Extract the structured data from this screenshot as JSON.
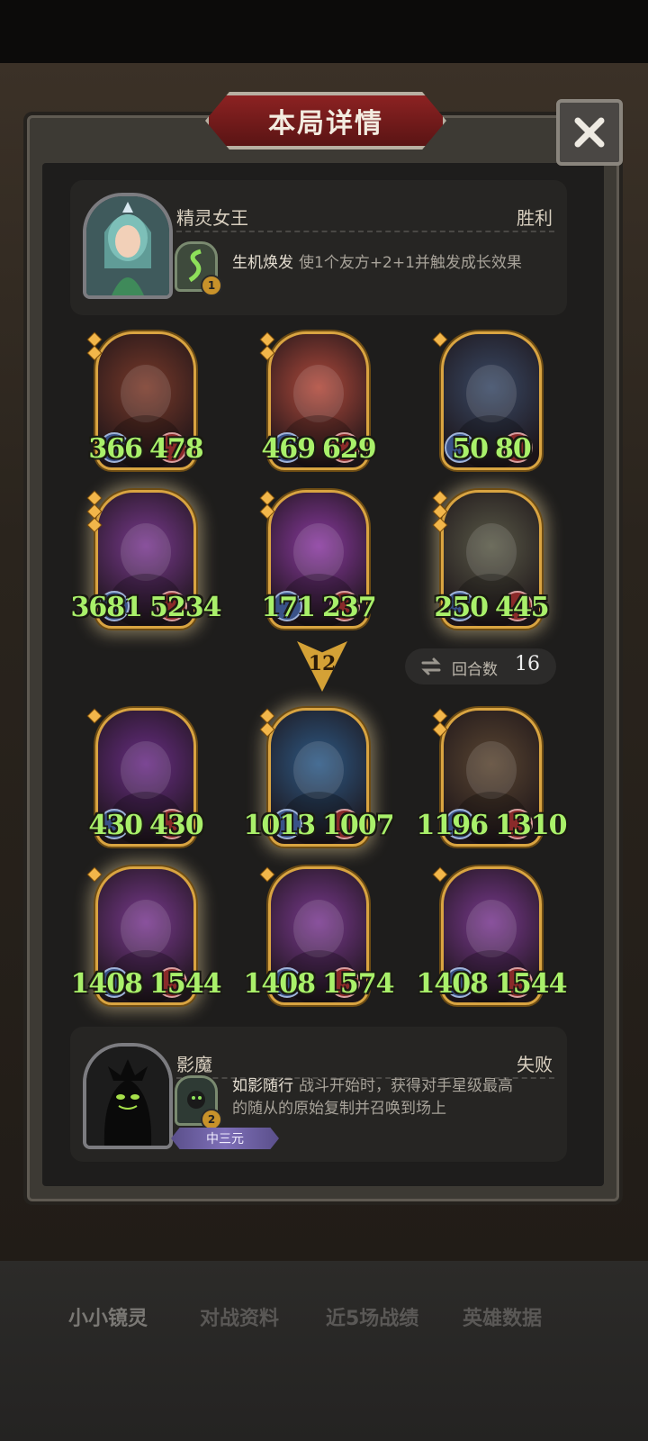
{
  "dialog": {
    "title": "本局详情"
  },
  "top_player": {
    "name": "精灵女王",
    "result": "胜利",
    "skill_level": "1",
    "skill_name": "生机焕发",
    "skill_desc": "使1个友方+2+1并触发成长效果"
  },
  "top_units": [
    {
      "atk": "366",
      "hp": "478",
      "stars": 2,
      "glow": false,
      "color": "#7a3a2a"
    },
    {
      "atk": "469",
      "hp": "629",
      "stars": 2,
      "glow": false,
      "color": "#b04a3c"
    },
    {
      "atk": "50",
      "hp": "80",
      "stars": 1,
      "glow": false,
      "color": "#3a4a66"
    },
    {
      "atk": "3681",
      "hp": "5234",
      "stars": 3,
      "glow": true,
      "color": "#7a3a90"
    },
    {
      "atk": "171",
      "hp": "237",
      "stars": 2,
      "glow": false,
      "color": "#8a3aa0"
    },
    {
      "atk": "250",
      "hp": "445",
      "stars": 3,
      "glow": true,
      "color": "#5a5a48"
    }
  ],
  "vs_marker": "12",
  "rounds": {
    "label": "回合数",
    "value": "16"
  },
  "bottom_units": [
    {
      "atk": "430",
      "hp": "430",
      "stars": 1,
      "glow": false,
      "color": "#6a2e86"
    },
    {
      "atk": "1013",
      "hp": "1007",
      "stars": 2,
      "glow": true,
      "color": "#2e5a86"
    },
    {
      "atk": "1196",
      "hp": "1310",
      "stars": 2,
      "glow": false,
      "color": "#5a4632"
    },
    {
      "atk": "1408",
      "hp": "1544",
      "stars": 1,
      "glow": true,
      "color": "#7a3a90"
    },
    {
      "atk": "1408",
      "hp": "1574",
      "stars": 1,
      "glow": false,
      "color": "#7a3a90"
    },
    {
      "atk": "1408",
      "hp": "1544",
      "stars": 1,
      "glow": false,
      "color": "#7a3a90"
    }
  ],
  "bottom_player": {
    "name": "影魔",
    "result": "失败",
    "skill_level": "2",
    "skill_name": "如影随行",
    "skill_desc_line1": "战斗开始时，获得对手星级最高",
    "skill_desc_line2": "的随从的原始复制并召唤到场上",
    "tag": "中三元"
  },
  "bottom_tabs": [
    "小小镜灵",
    "对战资料",
    "近5场战绩",
    "英雄数据"
  ]
}
